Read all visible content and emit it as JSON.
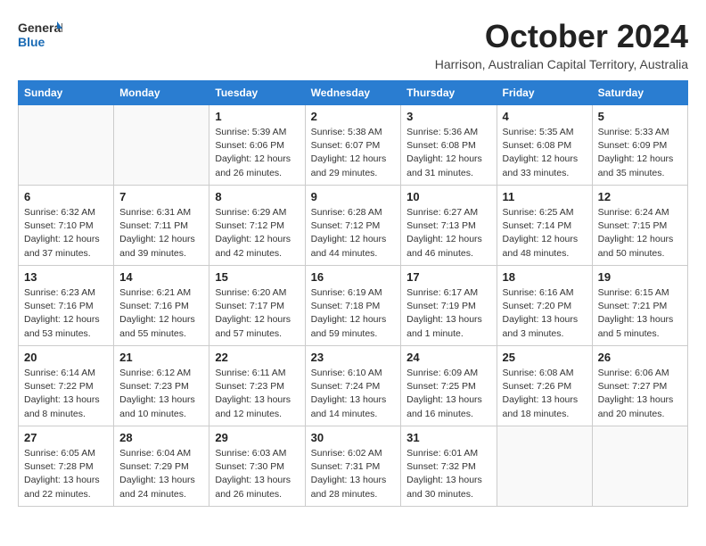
{
  "header": {
    "logo_general": "General",
    "logo_blue": "Blue",
    "title": "October 2024",
    "location": "Harrison, Australian Capital Territory, Australia"
  },
  "weekdays": [
    "Sunday",
    "Monday",
    "Tuesday",
    "Wednesday",
    "Thursday",
    "Friday",
    "Saturday"
  ],
  "weeks": [
    [
      {
        "day": "",
        "info": ""
      },
      {
        "day": "",
        "info": ""
      },
      {
        "day": "1",
        "info": "Sunrise: 5:39 AM\nSunset: 6:06 PM\nDaylight: 12 hours\nand 26 minutes."
      },
      {
        "day": "2",
        "info": "Sunrise: 5:38 AM\nSunset: 6:07 PM\nDaylight: 12 hours\nand 29 minutes."
      },
      {
        "day": "3",
        "info": "Sunrise: 5:36 AM\nSunset: 6:08 PM\nDaylight: 12 hours\nand 31 minutes."
      },
      {
        "day": "4",
        "info": "Sunrise: 5:35 AM\nSunset: 6:08 PM\nDaylight: 12 hours\nand 33 minutes."
      },
      {
        "day": "5",
        "info": "Sunrise: 5:33 AM\nSunset: 6:09 PM\nDaylight: 12 hours\nand 35 minutes."
      }
    ],
    [
      {
        "day": "6",
        "info": "Sunrise: 6:32 AM\nSunset: 7:10 PM\nDaylight: 12 hours\nand 37 minutes."
      },
      {
        "day": "7",
        "info": "Sunrise: 6:31 AM\nSunset: 7:11 PM\nDaylight: 12 hours\nand 39 minutes."
      },
      {
        "day": "8",
        "info": "Sunrise: 6:29 AM\nSunset: 7:12 PM\nDaylight: 12 hours\nand 42 minutes."
      },
      {
        "day": "9",
        "info": "Sunrise: 6:28 AM\nSunset: 7:12 PM\nDaylight: 12 hours\nand 44 minutes."
      },
      {
        "day": "10",
        "info": "Sunrise: 6:27 AM\nSunset: 7:13 PM\nDaylight: 12 hours\nand 46 minutes."
      },
      {
        "day": "11",
        "info": "Sunrise: 6:25 AM\nSunset: 7:14 PM\nDaylight: 12 hours\nand 48 minutes."
      },
      {
        "day": "12",
        "info": "Sunrise: 6:24 AM\nSunset: 7:15 PM\nDaylight: 12 hours\nand 50 minutes."
      }
    ],
    [
      {
        "day": "13",
        "info": "Sunrise: 6:23 AM\nSunset: 7:16 PM\nDaylight: 12 hours\nand 53 minutes."
      },
      {
        "day": "14",
        "info": "Sunrise: 6:21 AM\nSunset: 7:16 PM\nDaylight: 12 hours\nand 55 minutes."
      },
      {
        "day": "15",
        "info": "Sunrise: 6:20 AM\nSunset: 7:17 PM\nDaylight: 12 hours\nand 57 minutes."
      },
      {
        "day": "16",
        "info": "Sunrise: 6:19 AM\nSunset: 7:18 PM\nDaylight: 12 hours\nand 59 minutes."
      },
      {
        "day": "17",
        "info": "Sunrise: 6:17 AM\nSunset: 7:19 PM\nDaylight: 13 hours\nand 1 minute."
      },
      {
        "day": "18",
        "info": "Sunrise: 6:16 AM\nSunset: 7:20 PM\nDaylight: 13 hours\nand 3 minutes."
      },
      {
        "day": "19",
        "info": "Sunrise: 6:15 AM\nSunset: 7:21 PM\nDaylight: 13 hours\nand 5 minutes."
      }
    ],
    [
      {
        "day": "20",
        "info": "Sunrise: 6:14 AM\nSunset: 7:22 PM\nDaylight: 13 hours\nand 8 minutes."
      },
      {
        "day": "21",
        "info": "Sunrise: 6:12 AM\nSunset: 7:23 PM\nDaylight: 13 hours\nand 10 minutes."
      },
      {
        "day": "22",
        "info": "Sunrise: 6:11 AM\nSunset: 7:23 PM\nDaylight: 13 hours\nand 12 minutes."
      },
      {
        "day": "23",
        "info": "Sunrise: 6:10 AM\nSunset: 7:24 PM\nDaylight: 13 hours\nand 14 minutes."
      },
      {
        "day": "24",
        "info": "Sunrise: 6:09 AM\nSunset: 7:25 PM\nDaylight: 13 hours\nand 16 minutes."
      },
      {
        "day": "25",
        "info": "Sunrise: 6:08 AM\nSunset: 7:26 PM\nDaylight: 13 hours\nand 18 minutes."
      },
      {
        "day": "26",
        "info": "Sunrise: 6:06 AM\nSunset: 7:27 PM\nDaylight: 13 hours\nand 20 minutes."
      }
    ],
    [
      {
        "day": "27",
        "info": "Sunrise: 6:05 AM\nSunset: 7:28 PM\nDaylight: 13 hours\nand 22 minutes."
      },
      {
        "day": "28",
        "info": "Sunrise: 6:04 AM\nSunset: 7:29 PM\nDaylight: 13 hours\nand 24 minutes."
      },
      {
        "day": "29",
        "info": "Sunrise: 6:03 AM\nSunset: 7:30 PM\nDaylight: 13 hours\nand 26 minutes."
      },
      {
        "day": "30",
        "info": "Sunrise: 6:02 AM\nSunset: 7:31 PM\nDaylight: 13 hours\nand 28 minutes."
      },
      {
        "day": "31",
        "info": "Sunrise: 6:01 AM\nSunset: 7:32 PM\nDaylight: 13 hours\nand 30 minutes."
      },
      {
        "day": "",
        "info": ""
      },
      {
        "day": "",
        "info": ""
      }
    ]
  ]
}
